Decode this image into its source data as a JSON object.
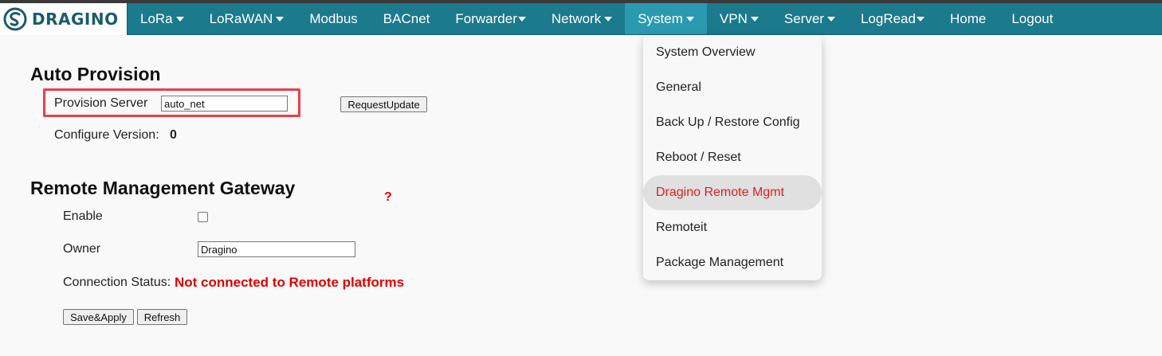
{
  "brand": {
    "name": "DRAGINO"
  },
  "nav": {
    "items": [
      {
        "label": "LoRa",
        "has_menu": true
      },
      {
        "label": "LoRaWAN",
        "has_menu": true
      },
      {
        "label": "Modbus",
        "has_menu": false
      },
      {
        "label": "BACnet",
        "has_menu": false
      },
      {
        "label": "Forwarder",
        "has_menu": true
      },
      {
        "label": "Network",
        "has_menu": true
      },
      {
        "label": "System",
        "has_menu": true,
        "active": true
      },
      {
        "label": "VPN",
        "has_menu": true
      },
      {
        "label": "Server",
        "has_menu": true
      },
      {
        "label": "LogRead",
        "has_menu": true
      },
      {
        "label": "Home",
        "has_menu": false
      },
      {
        "label": "Logout",
        "has_menu": false
      }
    ]
  },
  "auto_provision": {
    "title": "Auto Provision",
    "server_label": "Provision Server",
    "server_value": "auto_net",
    "request_button": "RequestUpdate",
    "version_label": "Configure Version:",
    "version_value": "0"
  },
  "remote_mgmt": {
    "title": "Remote Management Gateway",
    "help_mark": "?",
    "enable_label": "Enable",
    "enable_checked": false,
    "owner_label": "Owner",
    "owner_value": "Dragino",
    "status_label": "Connection Status:",
    "status_value": "Not connected to Remote platforms",
    "save_button": "Save&Apply",
    "refresh_button": "Refresh"
  },
  "system_menu": {
    "items": [
      {
        "label": "System Overview"
      },
      {
        "label": "General"
      },
      {
        "label": "Back Up / Restore Config"
      },
      {
        "label": "Reboot / Reset"
      },
      {
        "label": "Dragino Remote Mgmt",
        "active": true
      },
      {
        "label": "Remoteit"
      },
      {
        "label": "Package Management"
      }
    ]
  },
  "colors": {
    "navbar": "#1b7a8c",
    "nav_active": "#2a9ab0",
    "alert_red": "#e00000",
    "highlight_box": "#e8404a"
  }
}
